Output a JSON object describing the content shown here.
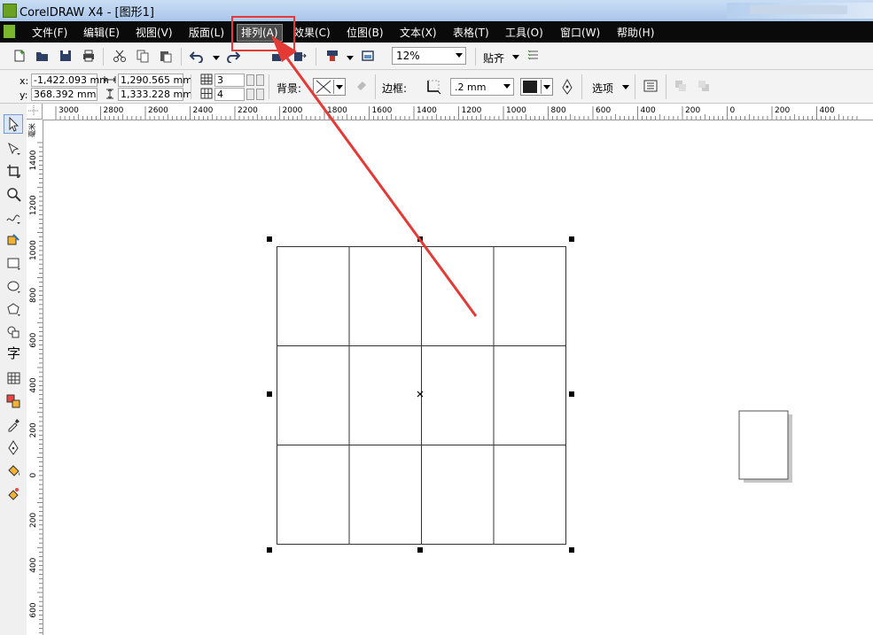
{
  "window": {
    "title": "CorelDRAW X4 - [图形1]"
  },
  "menu": {
    "items": [
      "文件(F)",
      "编辑(E)",
      "视图(V)",
      "版面(L)",
      "排列(A)",
      "效果(C)",
      "位图(B)",
      "文本(X)",
      "表格(T)",
      "工具(O)",
      "窗口(W)",
      "帮助(H)"
    ],
    "highlighted": "排列(A)"
  },
  "toolbar": {
    "zoom_value": "12%",
    "snap_label": "贴齐",
    "icons": [
      "new-icon",
      "open-icon",
      "save-icon",
      "print-icon",
      "cut-icon",
      "copy-icon",
      "paste-icon",
      "undo-icon",
      "redo-icon",
      "import-icon",
      "export-icon",
      "launcher-icon",
      "welcome-icon",
      "snap-options-icon"
    ]
  },
  "property_bar": {
    "x_label": "x:",
    "x_value": "-1,422.093 mm",
    "y_label": "y:",
    "y_value": "368.392 mm",
    "width_value": "1,290.565 mm",
    "height_value": "1,333.228 mm",
    "rows_value": "3",
    "cols_value": "4",
    "background_label": "背景:",
    "border_label": "边框:",
    "border_width_value": ".2 mm",
    "options_label": "选项",
    "accent_color": "#1e1e1e"
  },
  "ruler": {
    "top_labels": [
      "3000",
      "2800",
      "2600",
      "2400",
      "2200",
      "2000",
      "1800",
      "1600",
      "1400",
      "1200",
      "1000",
      "800",
      "600",
      "400",
      "200",
      "0",
      "200",
      "400"
    ],
    "left_labels": [
      "1400",
      "1200",
      "1000",
      "800",
      "600",
      "400",
      "200",
      "0",
      "200",
      "400",
      "600"
    ],
    "unit": "毫米"
  },
  "toolbox": {
    "tools": [
      "pick-tool-icon",
      "shape-tool-icon",
      "crop-tool-icon",
      "zoom-tool-icon",
      "freehand-tool-icon",
      "smart-fill-icon",
      "rectangle-tool-icon",
      "ellipse-tool-icon",
      "polygon-tool-icon",
      "basic-shapes-icon",
      "text-tool-icon",
      "table-tool-icon",
      "interactive-blend-icon",
      "eyedropper-icon",
      "outline-tool-icon",
      "fill-tool-icon",
      "interactive-fill-icon"
    ],
    "text_tool_glyph": "字"
  },
  "canvas": {
    "table": {
      "rows": 3,
      "cols": 4
    },
    "annotation_color": "#e53935"
  }
}
